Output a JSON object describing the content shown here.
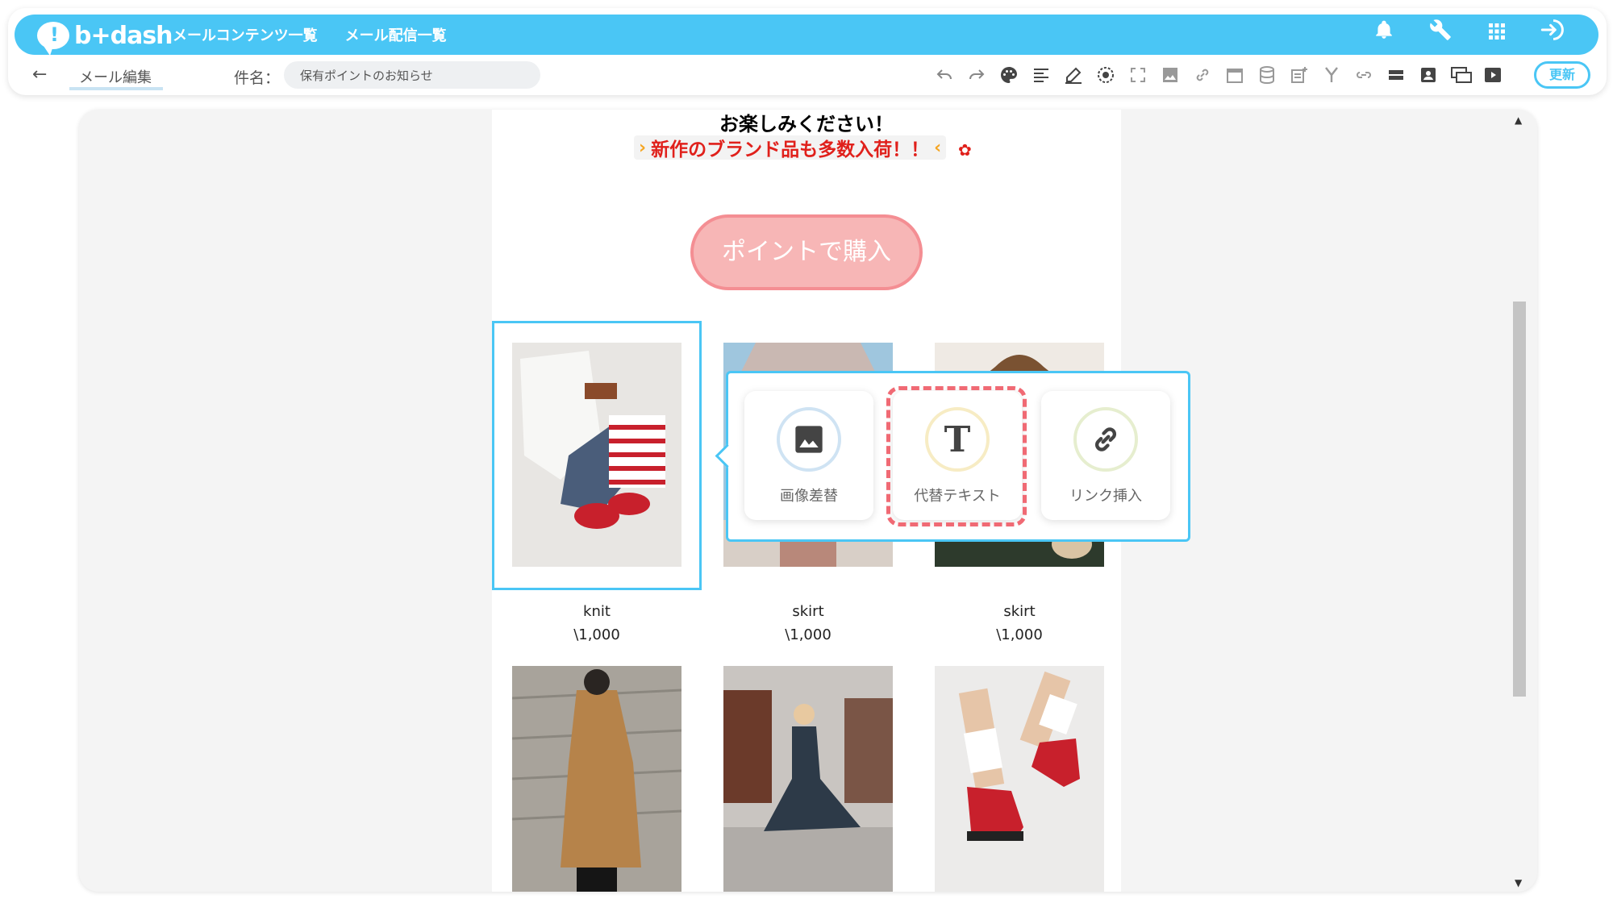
{
  "app": {
    "logo_mark": "!",
    "logo_text": "b+dash"
  },
  "topnav": {
    "items": [
      {
        "label": "メールコンテンツ一覧"
      },
      {
        "label": "メール配信一覧"
      }
    ]
  },
  "top_icons": [
    "bell-icon",
    "wrench-icon",
    "grid-icon",
    "sign-in-icon"
  ],
  "subbar": {
    "title": "メール編集",
    "subject_label": "件名：",
    "subject_value": "保有ポイントのお知らせ",
    "update_label": "更新"
  },
  "toolbar": [
    "undo-icon",
    "redo-icon",
    "palette-icon",
    "align-text-icon",
    "pen-icon",
    "target-icon",
    "expand-icon",
    "image-icon",
    "link-icon",
    "calendar-icon",
    "database-icon",
    "note-add-icon",
    "merge-icon",
    "link-off-icon",
    "divider-icon",
    "person-card-icon",
    "multi-window-icon",
    "video-icon"
  ],
  "email": {
    "headline": "お楽しみください！",
    "promo_text": "新作のブランド品も多数入荷！！",
    "cta_label": "ポイントで購入",
    "products_row1": [
      {
        "name": "knit",
        "price": "\\1,000"
      },
      {
        "name": "skirt",
        "price": "\\1,000"
      },
      {
        "name": "skirt",
        "price": "\\1,000"
      }
    ]
  },
  "popup": {
    "buttons": [
      {
        "label": "画像差替",
        "ring": "#cfe3f3"
      },
      {
        "label": "代替テキスト",
        "glyph": "T",
        "ring": "#f7ecc4"
      },
      {
        "label": "リンク挿入",
        "ring": "#e6eecf"
      }
    ]
  },
  "colors": {
    "brand": "#4ac6f5",
    "promo_red": "#e0201b",
    "cta_fill": "#f7b6b6",
    "dashed_highlight": "#f06a74"
  }
}
